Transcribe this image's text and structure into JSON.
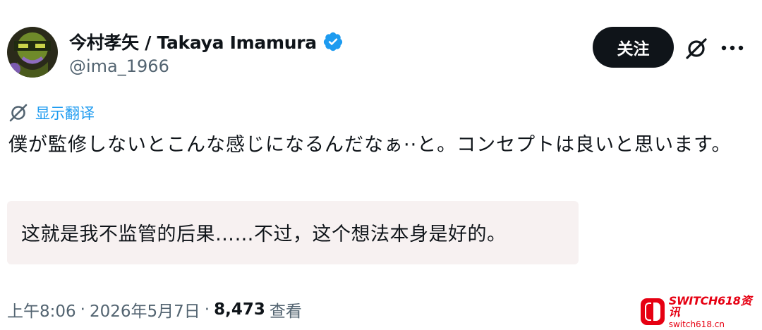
{
  "author": {
    "display_name": "今村孝矢 / Takaya Imamura",
    "handle": "@ima_1966",
    "verified_icon": "verified-badge-icon"
  },
  "actions": {
    "follow_label": "关注",
    "grok_icon": "grok-icon",
    "more_icon": "more-dots-icon"
  },
  "translate": {
    "label": "显示翻译",
    "icon": "grok-icon"
  },
  "post": {
    "text": "僕が監修しないとこんな感じになるんだなぁ··と。コンセプトは良いと思います。"
  },
  "translation_note": {
    "text": "这就是我不监管的后果……不过，这个想法本身是好的。"
  },
  "meta": {
    "time": "上午8:06",
    "separator": "·",
    "date": "2026年5月7日",
    "views_count": "8,473",
    "views_label": "查看"
  },
  "watermark": {
    "title": "SWITCH618资讯",
    "subtitle": "switch618.cn"
  },
  "colors": {
    "text": "#0f1419",
    "secondary": "#536471",
    "accent": "#1d9bf0",
    "follow_bg": "#0f1419",
    "quote_bg": "#f7f1f1",
    "watermark": "#e60012"
  }
}
